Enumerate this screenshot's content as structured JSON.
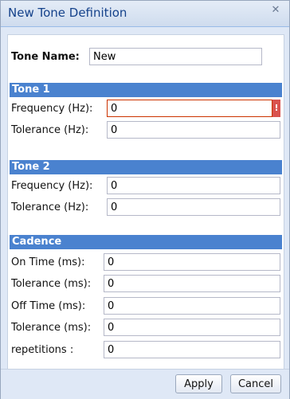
{
  "dialog": {
    "title": "New Tone Definition",
    "close_icon": "close-icon"
  },
  "tone_name": {
    "label": "Tone Name:",
    "value": "New"
  },
  "tone1": {
    "header": "Tone 1",
    "frequency_label": "Frequency (Hz):",
    "frequency_value": "0",
    "frequency_error_icon": "!",
    "tolerance_label": "Tolerance (Hz):",
    "tolerance_value": "0"
  },
  "tone2": {
    "header": "Tone 2",
    "frequency_label": "Frequency (Hz):",
    "frequency_value": "0",
    "tolerance_label": "Tolerance (Hz):",
    "tolerance_value": "0"
  },
  "cadence": {
    "header": "Cadence",
    "on_time_label": "On Time (ms):",
    "on_time_value": "0",
    "on_tolerance_label": "Tolerance (ms):",
    "on_tolerance_value": "0",
    "off_time_label": "Off Time (ms):",
    "off_time_value": "0",
    "off_tolerance_label": "Tolerance (ms):",
    "off_tolerance_value": "0",
    "repetitions_label": "repetitions :",
    "repetitions_value": "0"
  },
  "buttons": {
    "apply": "Apply",
    "cancel": "Cancel"
  },
  "colors": {
    "section_header": "#4a82cf",
    "title_text": "#15428b",
    "error": "#d9534f"
  }
}
